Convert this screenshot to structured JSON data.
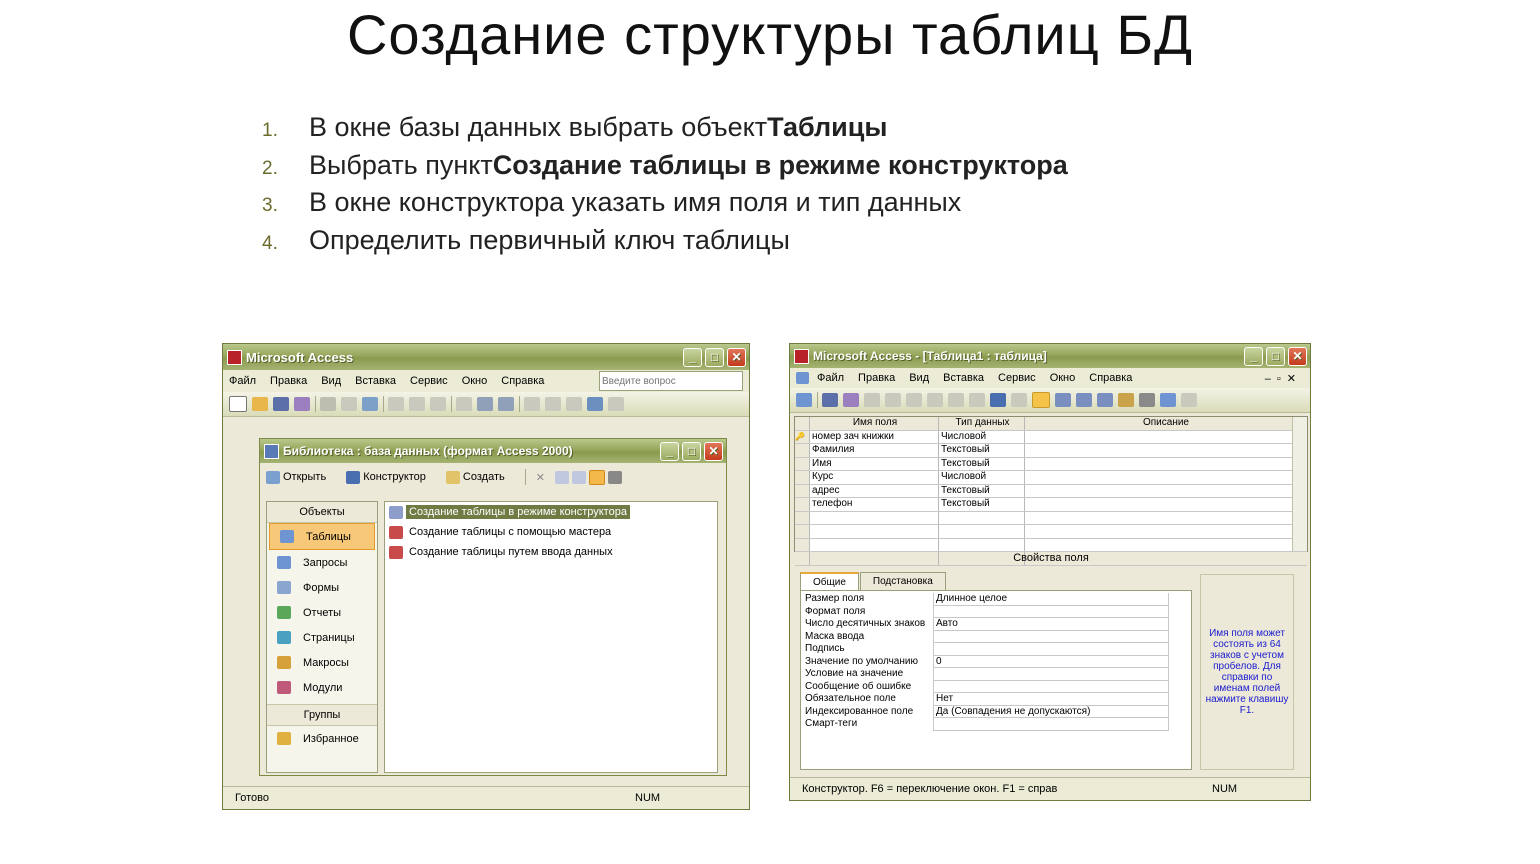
{
  "slide": {
    "title": "Создание структуры таблиц БД",
    "steps": [
      {
        "num": "1.",
        "text": "В окне базы данных выбрать объект ",
        "bold": "Таблицы"
      },
      {
        "num": "2.",
        "text": "Выбрать пункт ",
        "bold": "Создание таблицы в режиме конструктора"
      },
      {
        "num": "3.",
        "text": "В окне конструктора указать имя поля и тип данных",
        "bold": ""
      },
      {
        "num": "4.",
        "text": "Определить первичный ключ таблицы",
        "bold": ""
      }
    ]
  },
  "left_window": {
    "title": "Microsoft Access",
    "menu": [
      "Файл",
      "Правка",
      "Вид",
      "Вставка",
      "Сервис",
      "Окно",
      "Справка"
    ],
    "ask_placeholder": "Введите вопрос",
    "db_window": {
      "title": "Библиотека : база данных (формат Access 2000)",
      "toolbar": {
        "open": "Открыть",
        "design": "Конструктор",
        "create": "Создать"
      },
      "objects_header": "Объекты",
      "objects": [
        "Таблицы",
        "Запросы",
        "Формы",
        "Отчеты",
        "Страницы",
        "Макросы",
        "Модули"
      ],
      "groups_header": "Группы",
      "groups": [
        "Избранное"
      ],
      "list": [
        "Создание таблицы в режиме конструктора",
        "Создание таблицы с помощью мастера",
        "Создание таблицы путем ввода данных"
      ]
    },
    "status": "Готово",
    "status_num": "NUM"
  },
  "right_window": {
    "title": "Microsoft Access - [Таблица1 : таблица]",
    "menu": [
      "Файл",
      "Правка",
      "Вид",
      "Вставка",
      "Сервис",
      "Окно",
      "Справка"
    ],
    "grid_headers": [
      "Имя поля",
      "Тип данных",
      "Описание"
    ],
    "fields": [
      {
        "name": "номер зач книжки",
        "type": "Числовой"
      },
      {
        "name": "Фамилия",
        "type": "Текстовый"
      },
      {
        "name": "Имя",
        "type": "Текстовый"
      },
      {
        "name": "Курс",
        "type": "Числовой"
      },
      {
        "name": "адрес",
        "type": "Текстовый"
      },
      {
        "name": "телефон",
        "type": "Текстовый"
      }
    ],
    "props_label": "Свойства поля",
    "tabs": [
      "Общие",
      "Подстановка"
    ],
    "properties": [
      {
        "label": "Размер поля",
        "value": "Длинное целое"
      },
      {
        "label": "Формат поля",
        "value": ""
      },
      {
        "label": "Число десятичных знаков",
        "value": "Авто"
      },
      {
        "label": "Маска ввода",
        "value": ""
      },
      {
        "label": "Подпись",
        "value": ""
      },
      {
        "label": "Значение по умолчанию",
        "value": "0"
      },
      {
        "label": "Условие на значение",
        "value": ""
      },
      {
        "label": "Сообщение об ошибке",
        "value": ""
      },
      {
        "label": "Обязательное поле",
        "value": "Нет"
      },
      {
        "label": "Индексированное поле",
        "value": "Да (Совпадения не допускаются)"
      },
      {
        "label": "Смарт-теги",
        "value": ""
      }
    ],
    "hint": "Имя поля может состоять из 64 знаков с учетом пробелов. Для справки по именам полей нажмите клавишу F1.",
    "status": "Конструктор.  F6 = переключение окон.  F1 = справ",
    "status_num": "NUM"
  }
}
